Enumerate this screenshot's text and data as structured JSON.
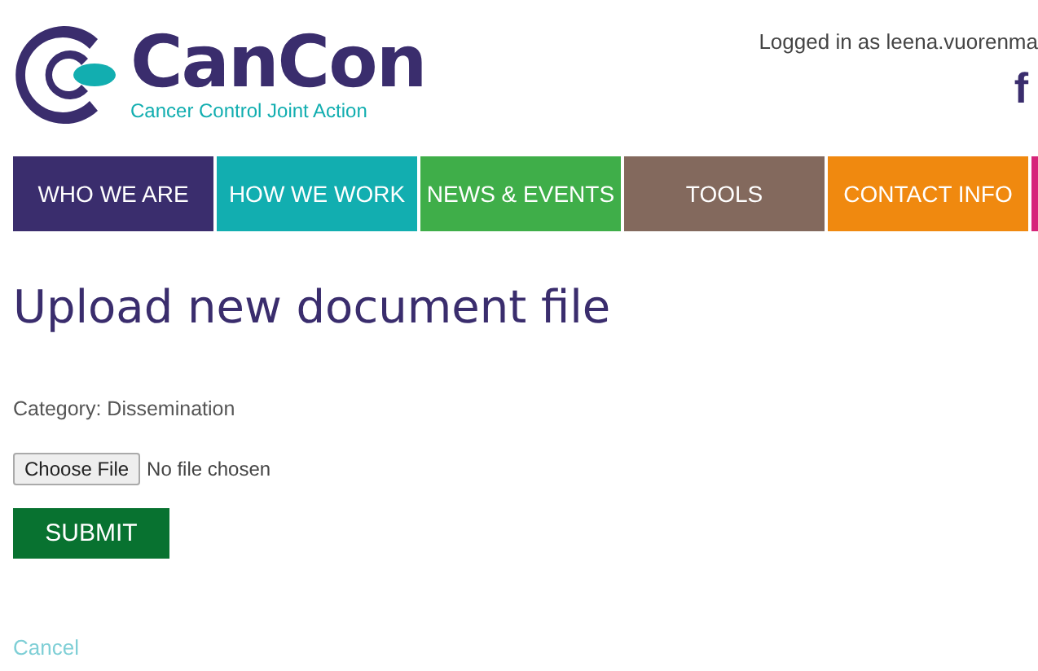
{
  "logo": {
    "name": "CanCon",
    "tagline": "Cancer Control Joint Action"
  },
  "user": {
    "logged_in": "Logged in as leena.vuorenma",
    "social": "f"
  },
  "nav": [
    {
      "label": "WHO WE ARE",
      "color": "#3a2d6d"
    },
    {
      "label": "HOW WE WORK",
      "color": "#12aeb0"
    },
    {
      "label": "NEWS & EVENTS",
      "color": "#3fae49"
    },
    {
      "label": "TOOLS",
      "color": "#83695d"
    },
    {
      "label": "CONTACT INFO",
      "color": "#f0890f"
    },
    {
      "color": "#d6257a"
    }
  ],
  "page": {
    "title": "Upload new document file",
    "category": "Category: Dissemination",
    "file_button": "Choose File",
    "file_status": "No file chosen",
    "submit": "SUBMIT",
    "cancel": "Cancel"
  }
}
